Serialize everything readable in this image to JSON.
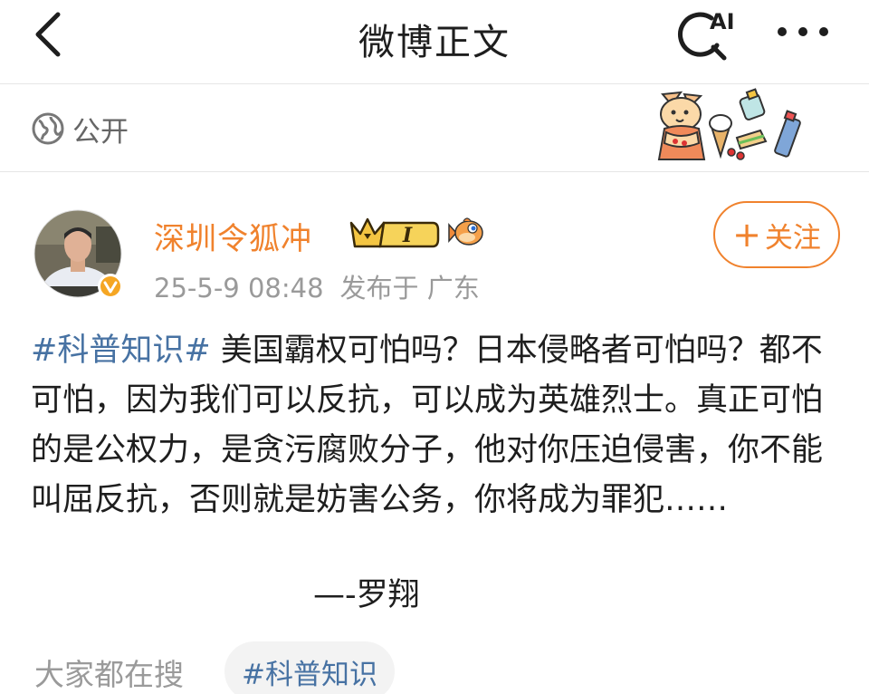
{
  "header": {
    "title": "微博正文",
    "back_icon": "chevron-left-icon",
    "ai_label": "AI",
    "ai_icon": "ai-search-icon",
    "more_icon": "more-dots-icon"
  },
  "visibility": {
    "icon": "globe-icon",
    "label": "公开"
  },
  "post": {
    "author": {
      "name": "深圳令狐冲",
      "vip_level": "I",
      "verified": true,
      "follow_label": "关注",
      "follow_plus": "+",
      "name_color": "#f0822d"
    },
    "meta": {
      "time": "25-5-9 08:48",
      "published_at": "发布于 广东"
    },
    "hashtag": "#科普知识#",
    "text": " 美国霸权可怕吗？日本侵略者可怕吗？都不可怕，因为我们可以反抗，可以成为英雄烈士。真正可怕的是公权力，是贪污腐败分子，他对你压迫侵害，你不能叫屈反抗，否则就是妨害公务，你将成为罪犯……",
    "signature": "—-罗翔"
  },
  "search": {
    "label": "大家都在搜",
    "chip": "#科普知识"
  },
  "colors": {
    "accent": "#f0822d",
    "link": "#4772a3",
    "muted": "#9a9a9a"
  }
}
